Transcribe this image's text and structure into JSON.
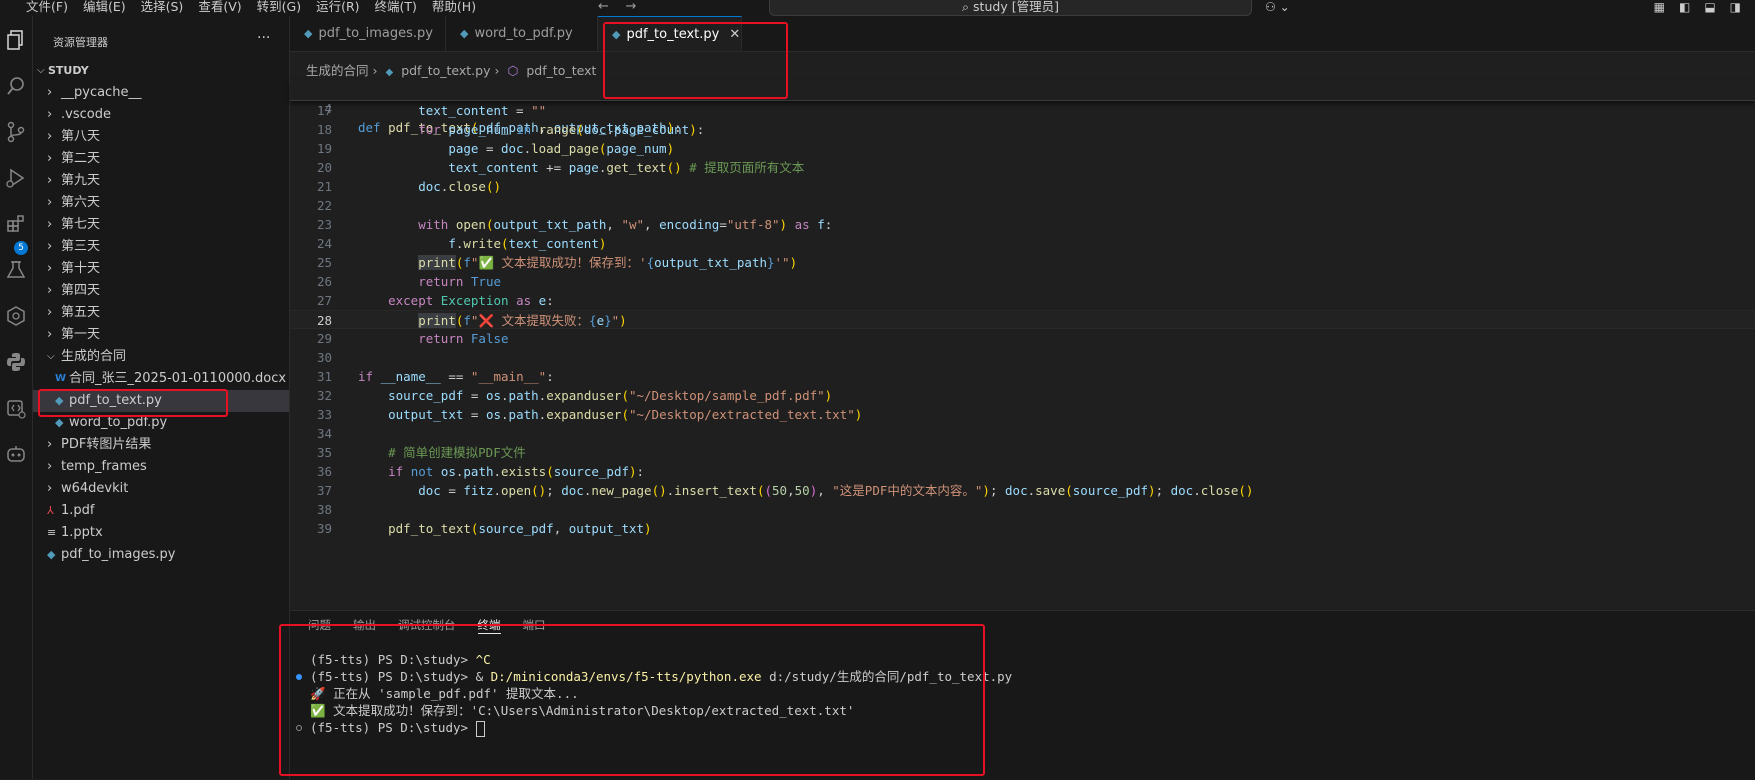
{
  "menubar": {
    "items": [
      "文件(F)",
      "编辑(E)",
      "选择(S)",
      "查看(V)",
      "转到(G)",
      "运行(R)",
      "终端(T)",
      "帮助(H)"
    ],
    "search": "study [管理员]"
  },
  "activity_bar": {
    "icons": [
      "explorer-icon",
      "search-icon",
      "source-control-icon",
      "run-debug-icon",
      "extensions-icon",
      "testing-icon",
      "remote-explorer-icon",
      "python-icon",
      "docker-icon",
      "copilot-icon"
    ],
    "extensions_badge": "5"
  },
  "explorer": {
    "title": "资源管理器",
    "more": "···",
    "root": "STUDY",
    "items": [
      {
        "label": "__pycache__",
        "type": "folder",
        "depth": 1
      },
      {
        "label": ".vscode",
        "type": "folder",
        "depth": 1
      },
      {
        "label": "第八天",
        "type": "folder",
        "depth": 1
      },
      {
        "label": "第二天",
        "type": "folder",
        "depth": 1
      },
      {
        "label": "第九天",
        "type": "folder",
        "depth": 1
      },
      {
        "label": "第六天",
        "type": "folder",
        "depth": 1
      },
      {
        "label": "第七天",
        "type": "folder",
        "depth": 1
      },
      {
        "label": "第三天",
        "type": "folder",
        "depth": 1
      },
      {
        "label": "第十天",
        "type": "folder",
        "depth": 1
      },
      {
        "label": "第四天",
        "type": "folder",
        "depth": 1
      },
      {
        "label": "第五天",
        "type": "folder",
        "depth": 1
      },
      {
        "label": "第一天",
        "type": "folder",
        "depth": 1
      },
      {
        "label": "生成的合同",
        "type": "folder-open",
        "depth": 1
      },
      {
        "label": "合同_张三_2025-01-0110000.docx",
        "type": "docx",
        "depth": 2
      },
      {
        "label": "pdf_to_text.py",
        "type": "py",
        "depth": 2,
        "selected": true
      },
      {
        "label": "word_to_pdf.py",
        "type": "py",
        "depth": 2
      },
      {
        "label": "PDF转图片结果",
        "type": "folder",
        "depth": 1
      },
      {
        "label": "temp_frames",
        "type": "folder",
        "depth": 1
      },
      {
        "label": "w64devkit",
        "type": "folder",
        "depth": 1
      },
      {
        "label": "1.pdf",
        "type": "pdf",
        "depth": 1
      },
      {
        "label": "1.pptx",
        "type": "pptx",
        "depth": 1
      },
      {
        "label": "pdf_to_images.py",
        "type": "py",
        "depth": 1
      }
    ]
  },
  "tabs": [
    {
      "label": "pdf_to_images.py",
      "active": false
    },
    {
      "label": "word_to_pdf.py",
      "active": false
    },
    {
      "label": "pdf_to_text.py",
      "active": true,
      "close": "✕"
    }
  ],
  "breadcrumb": [
    "生成的合同",
    "pdf_to_text.py",
    "pdf_to_text"
  ],
  "code": {
    "sticky_line": "4",
    "line_numbers": [
      "17",
      "18",
      "19",
      "20",
      "21",
      "22",
      "23",
      "24",
      "25",
      "26",
      "27",
      "28",
      "29",
      "30",
      "31",
      "32",
      "33",
      "34",
      "35",
      "36",
      "37",
      "38",
      "39"
    ],
    "current_line": "28"
  },
  "panel": {
    "tabs": [
      "问题",
      "输出",
      "调试控制台",
      "终端",
      "端口"
    ],
    "active_tab": "终端",
    "terminal": [
      "(f5-tts) PS D:\\study> ",
      "^C",
      "(f5-tts) PS D:\\study> & ",
      "D:/miniconda3/envs/f5-tts/python.exe",
      " d:/study/生成的合同/pdf_to_text.py",
      "🚀 正在从 'sample_pdf.pdf' 提取文本...",
      "✅ 文本提取成功！保存到：'C:\\Users\\Administrator\\Desktop/extracted_text.txt'",
      "(f5-tts) PS D:\\study> "
    ]
  },
  "colors": {
    "accent": "#0078d4",
    "highlight_box": "#e81123",
    "python_icon": "#519aba"
  }
}
